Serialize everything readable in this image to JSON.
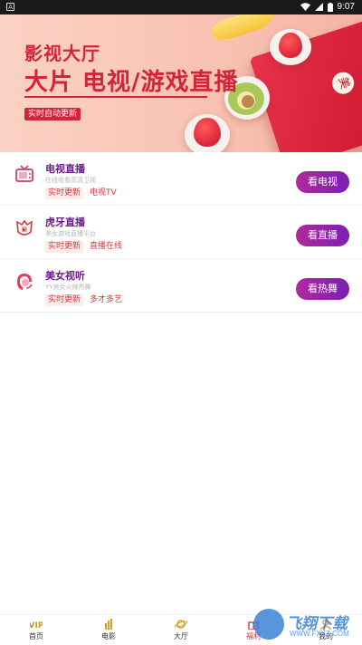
{
  "status_bar": {
    "time": "9:07",
    "icons": [
      "wifi-icon",
      "signal-icon",
      "battery-icon"
    ]
  },
  "banner": {
    "kicker": "影视大厅",
    "headline": "大片 电视/游戏直播",
    "tagline": "实时自动更新",
    "badge_char": "美"
  },
  "channels": [
    {
      "title": "电视直播",
      "subtitle": "在线收看高清卫视",
      "tags": [
        "实时更新",
        "电视TV"
      ],
      "action": "看电视",
      "icon": "tv-icon"
    },
    {
      "title": "虎牙直播",
      "subtitle": "美女游戏直播平台",
      "tags": [
        "实时更新",
        "直播在线"
      ],
      "action": "看直播",
      "icon": "huya-icon"
    },
    {
      "title": "美女视听",
      "subtitle": "YY美女火辣热舞",
      "tags": [
        "实时更新",
        "多才多艺"
      ],
      "action": "看热舞",
      "icon": "girl-icon"
    }
  ],
  "bottom_nav": [
    {
      "label": "首页",
      "icon": "vip-icon"
    },
    {
      "label": "电影",
      "icon": "film-icon"
    },
    {
      "label": "大厅",
      "icon": "planet-icon"
    },
    {
      "label": "福利",
      "icon": "gift-icon",
      "active": true
    },
    {
      "label": "我的",
      "icon": "user-icon"
    }
  ],
  "watermark": {
    "brand": "飞翔下载",
    "url": "WWW.FXXZ.COM"
  },
  "colors": {
    "accent_purple": "#7b1fb6",
    "accent_magenta": "#b02a9a",
    "brand_red": "#d2253a",
    "banner_bg": "#f9c6b6"
  }
}
